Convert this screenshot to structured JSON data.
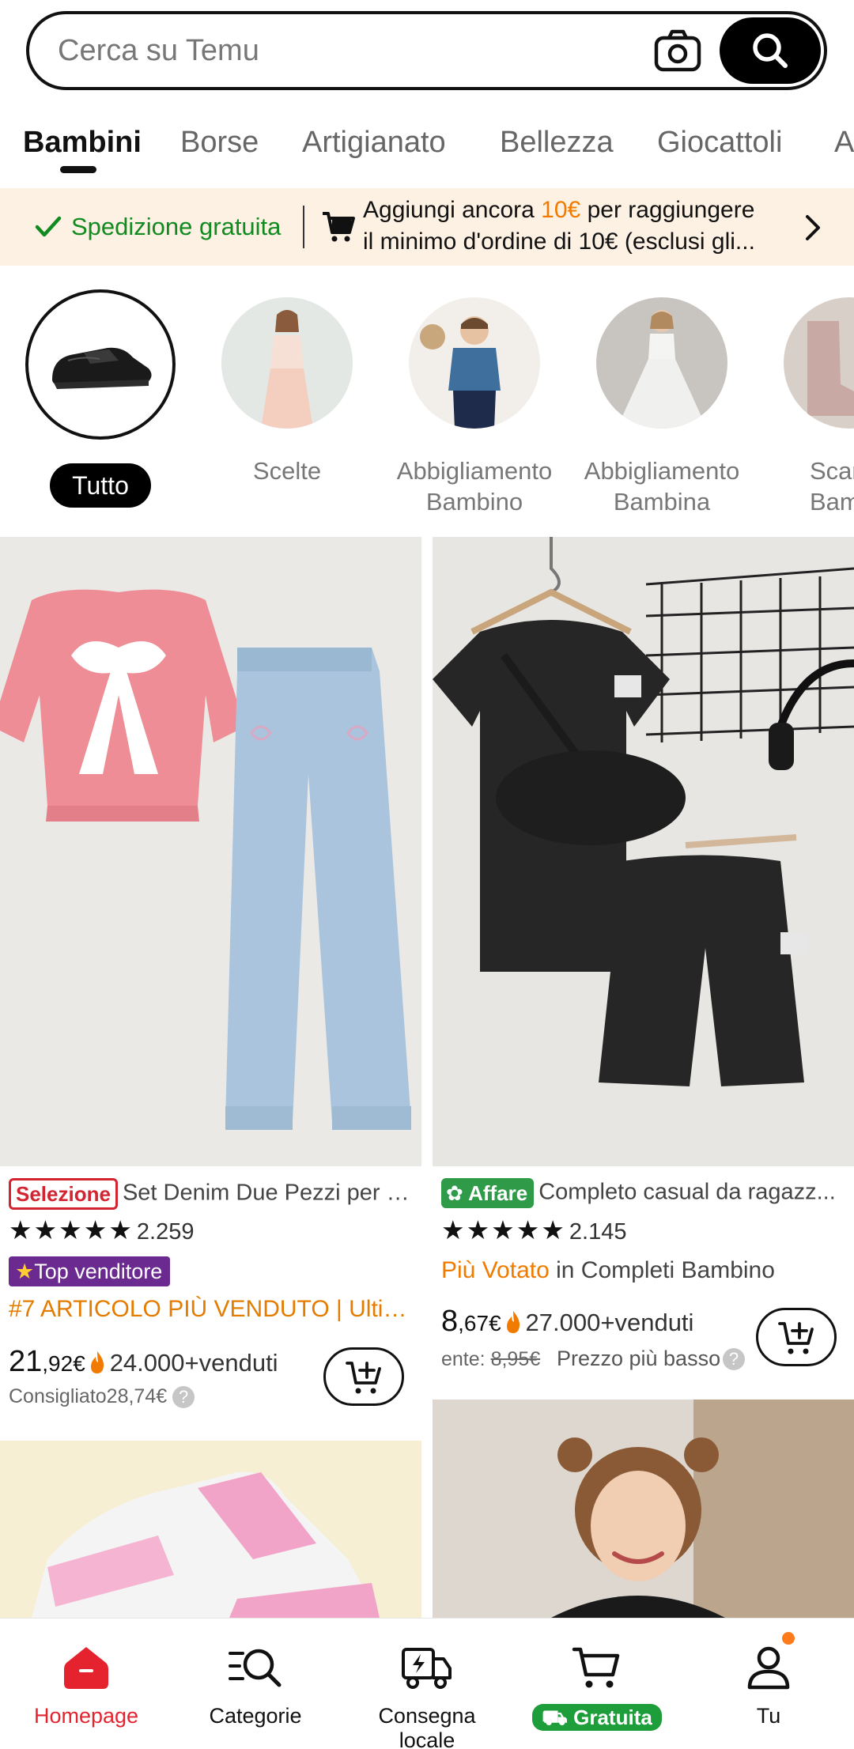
{
  "search": {
    "placeholder": "Cerca su Temu"
  },
  "tabs": [
    {
      "label": "Bambini",
      "active": true
    },
    {
      "label": "Borse"
    },
    {
      "label": "Artigianato"
    },
    {
      "label": "Bellezza"
    },
    {
      "label": "Giocattoli"
    },
    {
      "label": "A"
    }
  ],
  "banner": {
    "free_shipping": "Spedizione gratuita",
    "line1_pre": "Aggiungi ancora ",
    "line1_amount": "10€",
    "line1_post": " per raggiungere",
    "line2": "il minimo d'ordine di 10€ (esclusi gli..."
  },
  "categories": [
    {
      "label": "Tutto",
      "active": true
    },
    {
      "label": "Scelte"
    },
    {
      "label": "Abbigliamento\nBambino"
    },
    {
      "label": "Abbigliamento\nBambina"
    },
    {
      "label": "Scar\nBamb"
    }
  ],
  "products": [
    {
      "badge": "Selezione",
      "title": "Set Denim Due Pezzi per R...",
      "rating_count": "2.259",
      "top_seller": "Top venditore",
      "highlight": "#7 ARTICOLO PIÙ VENDUTO | Ultim...",
      "price_int": "21",
      "price_dec": ",92€",
      "sold": "24.000+venduti",
      "recommended": "Consigliato28,74€"
    },
    {
      "badge": "Affare",
      "title": "Completo casual da ragazz...",
      "rating_count": "2.145",
      "rank_prefix": "Più Votato",
      "rank_suffix": " in Completi Bambino",
      "price_int": "8",
      "price_dec": ",67€",
      "sold": "27.000+venduti",
      "prev_label": "ente: ",
      "prev_price": "8,95€",
      "lowest": "Prezzo più basso"
    }
  ],
  "bottom_nav": [
    {
      "label": "Homepage",
      "active": true
    },
    {
      "label": "Categorie"
    },
    {
      "label": "Consegna locale"
    },
    {
      "label": "Gratuita"
    },
    {
      "label": "Tu"
    }
  ],
  "colors": {
    "accent_red": "#e5232f",
    "free_green": "#118a20",
    "promo_orange": "#f07b00",
    "affare_green": "#2f9b48",
    "top_seller_purple": "#6b2a8f"
  }
}
